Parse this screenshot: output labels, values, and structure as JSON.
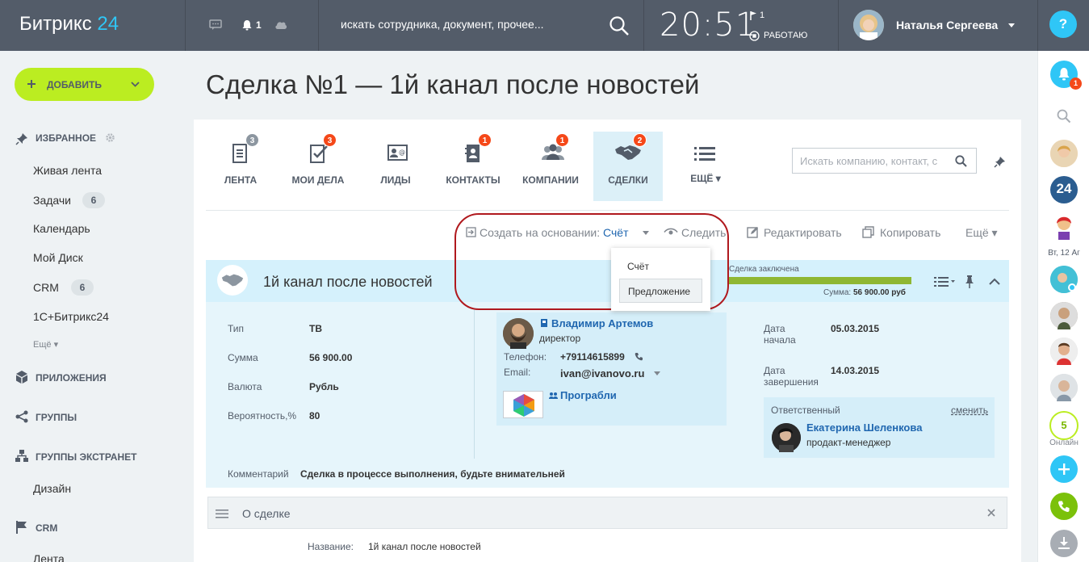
{
  "topbar": {
    "logo_text": "Битрикс",
    "logo_num": "24",
    "bell_count": "1",
    "search_placeholder": "искать сотрудника, документ, прочее...",
    "clock": "20:51",
    "flag_count": "1",
    "work_status": "РАБОТАЮ",
    "user_name": "Наталья Сергеева",
    "help": "?"
  },
  "left_menu": {
    "add_button": "ДОБАВИТЬ",
    "favorites": "ИЗБРАННОЕ",
    "items": [
      {
        "label": "Живая лента"
      },
      {
        "label": "Задачи",
        "count": "6"
      },
      {
        "label": "Календарь"
      },
      {
        "label": "Мой Диск"
      },
      {
        "label": "CRM",
        "count": "6"
      },
      {
        "label": "1С+Битрикс24"
      }
    ],
    "more": "Ещё",
    "apps": "ПРИЛОЖЕНИЯ",
    "groups": "ГРУППЫ",
    "extranet": "ГРУППЫ ЭКСТРАНЕТ",
    "design": "Дизайн",
    "crm": "CRM",
    "feed": "Лента"
  },
  "page_title": "Сделка №1 — 1й канал после новостей",
  "crm_tabs": [
    {
      "label": "ЛЕНТА",
      "badge": "3"
    },
    {
      "label": "МОИ ДЕЛА",
      "badge": "3"
    },
    {
      "label": "ЛИДЫ",
      "badge": ""
    },
    {
      "label": "КОНТАКТЫ",
      "badge": "1"
    },
    {
      "label": "КОМПАНИИ",
      "badge": "1"
    },
    {
      "label": "СДЕЛКИ",
      "badge": "2"
    },
    {
      "label": "ЕЩЁ",
      "badge": ""
    }
  ],
  "crm_search_placeholder": "Искать компанию, контакт, с",
  "toolbar": {
    "create_based": "Создать на основании:",
    "create_target": "Счёт",
    "follow": "Следить",
    "edit": "Редактировать",
    "copy": "Копировать",
    "more": "Ещё"
  },
  "popup": {
    "item1": "Счёт",
    "item2": "Предложение"
  },
  "deal": {
    "name": "1й канал после новостей",
    "stage": "Сделка заключена",
    "sum_label": "Сумма:",
    "sum_value": "56 900.00 руб",
    "stage_fill": 1.0,
    "fields": [
      {
        "label": "Тип",
        "value": "ТВ"
      },
      {
        "label": "Сумма",
        "value": "56 900.00"
      },
      {
        "label": "Валюта",
        "value": "Рубль"
      },
      {
        "label": "Вероятность,%",
        "value": "80"
      }
    ],
    "comment_label": "Комментарий",
    "comment": "Сделка в процессе выполнения, будьте внимательней",
    "contact": {
      "name": "Владимир Артемов",
      "post": "директор",
      "phone_label": "Телефон:",
      "phone": "+79114615899",
      "email_label": "Email:",
      "email": "ivan@ivanovo.ru",
      "company": "Програбли"
    },
    "start_label_1": "Дата",
    "start_label_2": "начала",
    "start_date": "05.03.2015",
    "end_label_1": "Дата",
    "end_label_2": "завершения",
    "end_date": "14.03.2015",
    "responsible_label": "Ответственный",
    "responsible_change": "сменить",
    "responsible_name": "Екатерина Шеленкова",
    "responsible_post": "продакт-менеджер"
  },
  "about": {
    "title": "О сделке",
    "name_label": "Название:",
    "name_value": "1й канал после новостей"
  },
  "right_bar": {
    "notif_count": "1",
    "date": "Вт, 12 Аг",
    "b24": "24",
    "online_count": "5",
    "online_label": "Онлайн"
  },
  "colors": {
    "topbar": "#535c69",
    "accent": "#2fc6f6",
    "add_button": "#bbed21",
    "badge": "#f54819",
    "stage": "#8fb733",
    "link": "#2067b0"
  }
}
